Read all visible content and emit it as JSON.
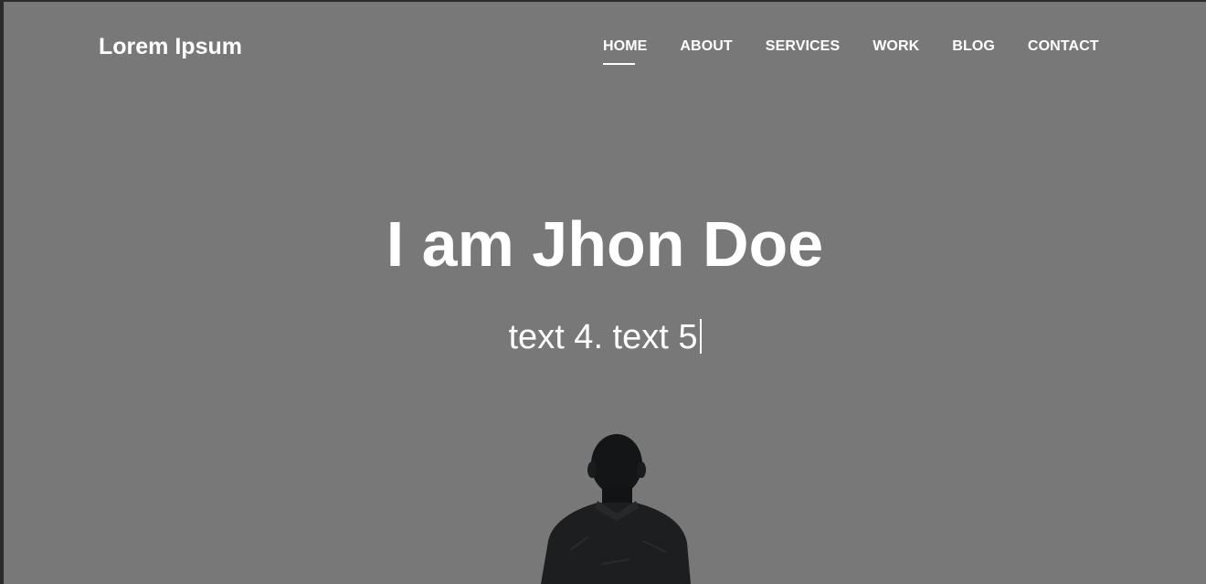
{
  "brand": {
    "name": "Lorem Ipsum"
  },
  "nav": {
    "items": [
      {
        "label": "HOME",
        "active": true
      },
      {
        "label": "ABOUT",
        "active": false
      },
      {
        "label": "SERVICES",
        "active": false
      },
      {
        "label": "WORK",
        "active": false
      },
      {
        "label": "BLOG",
        "active": false
      },
      {
        "label": "CONTACT",
        "active": false
      }
    ]
  },
  "hero": {
    "headline": "I am Jhon Doe",
    "typed_text": "text 4. text 5",
    "background_color": "#777877",
    "text_color": "#ffffff",
    "image": "person-silhouette-from-behind"
  }
}
